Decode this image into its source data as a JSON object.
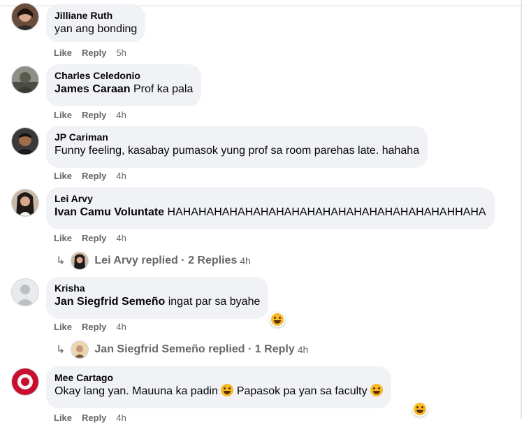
{
  "comments": [
    {
      "name": "Jilliane Ruth",
      "text": "yan ang bonding",
      "like": "Like",
      "reply": "Reply",
      "time": "5h"
    },
    {
      "name": "Charles Celedonio",
      "mention": "James Caraan",
      "text": " Prof ka pala",
      "like": "Like",
      "reply": "Reply",
      "time": "4h"
    },
    {
      "name": "JP Cariman",
      "text": "Funny feeling, kasabay pumasok yung prof sa room parehas late. hahaha",
      "like": "Like",
      "reply": "Reply",
      "time": "4h"
    },
    {
      "name": "Lei Arvy",
      "mention": "Ivan Camu Voluntate",
      "text": " HAHAHAHAHAHAHAHAHAHAHAHAHAHAHAHAHAHAHHAHA",
      "like": "Like",
      "reply": "Reply",
      "time": "4h",
      "replies": {
        "text": "Lei Arvy replied · 2 Replies",
        "time": "4h"
      }
    },
    {
      "name": "Krisha",
      "mention": "Jan Siegfrid Semeño",
      "text": " ingat par sa byahe",
      "like": "Like",
      "reply": "Reply",
      "time": "4h",
      "replies": {
        "text": "Jan Siegfrid Semeño replied · 1 Reply",
        "time": "4h"
      }
    },
    {
      "name": "Mee Cartago",
      "text1": "Okay lang yan. Mauuna ka padin ",
      "text2": " Papasok pa yan sa faculty ",
      "like": "Like",
      "reply": "Reply",
      "time": "4h"
    }
  ],
  "icons": {
    "reply_arrow": "reply-arrow-icon",
    "reaction": "laughing-emoji-icon"
  },
  "colors": {
    "bubble": "#f0f2f5",
    "meta": "#65676b",
    "text": "#050505"
  }
}
